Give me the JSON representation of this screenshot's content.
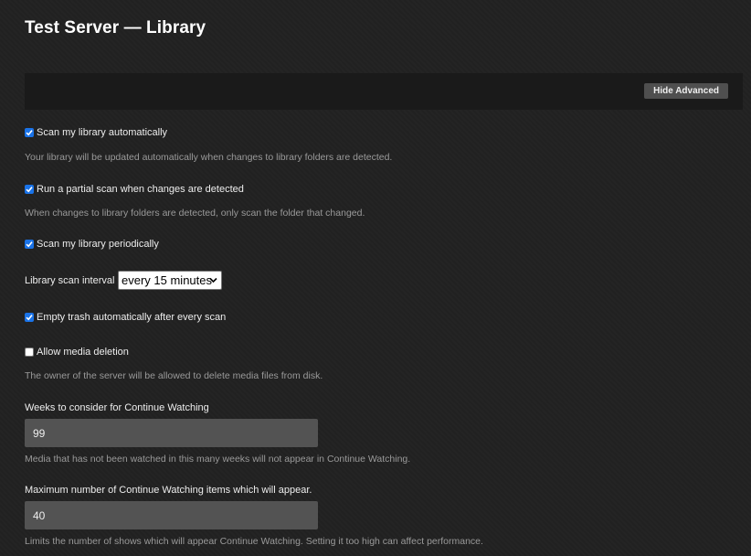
{
  "page": {
    "title": "Test Server — Library"
  },
  "toolbar": {
    "hide_advanced_label": "Hide Advanced"
  },
  "settings": {
    "scan_auto": {
      "label": "Scan my library automatically",
      "checked": true,
      "help": "Your library will be updated automatically when changes to library folders are detected."
    },
    "partial_scan": {
      "label": "Run a partial scan when changes are detected",
      "checked": true,
      "help": "When changes to library folders are detected, only scan the folder that changed."
    },
    "scan_periodic": {
      "label": "Scan my library periodically",
      "checked": true
    },
    "scan_interval": {
      "label": "Library scan interval",
      "value": "every 15 minutes"
    },
    "empty_trash": {
      "label": "Empty trash automatically after every scan",
      "checked": true
    },
    "media_deletion": {
      "label": "Allow media deletion",
      "checked": false,
      "help": "The owner of the server will be allowed to delete media files from disk."
    },
    "continue_weeks": {
      "label": "Weeks to consider for Continue Watching",
      "value": "99",
      "help": "Media that has not been watched in this many weeks will not appear in Continue Watching."
    },
    "continue_max": {
      "label": "Maximum number of Continue Watching items which will appear.",
      "value": "40",
      "help": "Limits the number of shows which will appear Continue Watching. Setting it too high can affect performance."
    }
  },
  "colors": {
    "background": "#212121",
    "checkbox_accent": "#1a73e8",
    "input_background": "#535353",
    "help_text": "#9a9a9a"
  }
}
